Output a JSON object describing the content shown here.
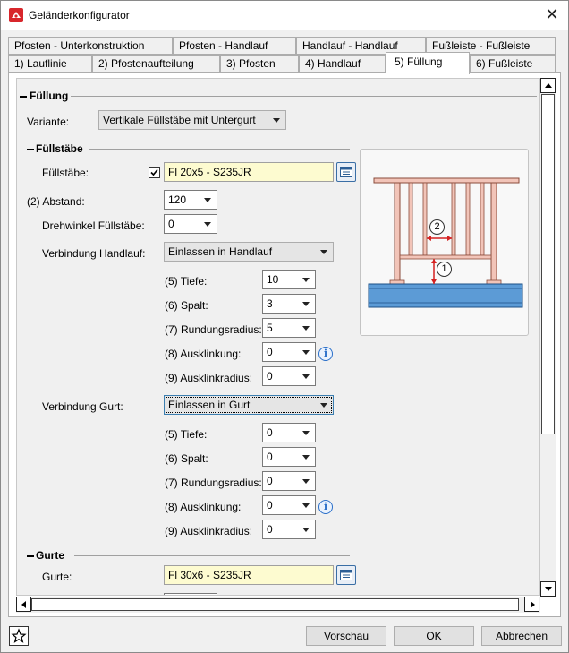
{
  "window": {
    "title": "Geländerkonfigurator"
  },
  "tabs_row1": [
    {
      "label": "Pfosten - Unterkonstruktion"
    },
    {
      "label": "Pfosten - Handlauf"
    },
    {
      "label": "Handlauf - Handlauf"
    },
    {
      "label": "Fußleiste - Fußleiste"
    }
  ],
  "tabs_row2": [
    {
      "label": "1) Lauflinie"
    },
    {
      "label": "2) Pfostenaufteilung"
    },
    {
      "label": "3) Pfosten"
    },
    {
      "label": "4) Handlauf"
    },
    {
      "label": "5) Füllung",
      "active": true
    },
    {
      "label": "6) Fußleiste"
    }
  ],
  "fuellung": {
    "section_title": "Füllung",
    "variante_label": "Variante:",
    "variante_value": "Vertikale Füllstäbe mit Untergurt"
  },
  "fuellstaebe": {
    "section_title": "Füllstäbe",
    "fuellstaebe_label": "Füllstäbe:",
    "fuellstaebe_checked": true,
    "fuellstaebe_value": "Fl 20x5 - S235JR",
    "abstand_label": "(2) Abstand:",
    "abstand_value": "120",
    "drehwinkel_label": "Drehwinkel Füllstäbe:",
    "drehwinkel_value": "0",
    "verbindung_handlauf_label": "Verbindung Handlauf:",
    "verbindung_handlauf_value": "Einlassen in Handlauf",
    "handlauf_params": [
      {
        "label": "(5) Tiefe:",
        "value": "10"
      },
      {
        "label": "(6) Spalt:",
        "value": "3"
      },
      {
        "label": "(7) Rundungsradius:",
        "value": "5"
      },
      {
        "label": "(8) Ausklinkung:",
        "value": "0"
      },
      {
        "label": "(9) Ausklinkradius:",
        "value": "0"
      }
    ],
    "verbindung_gurt_label": "Verbindung Gurt:",
    "verbindung_gurt_value": "Einlassen in Gurt",
    "gurt_params": [
      {
        "label": "(5) Tiefe:",
        "value": "0"
      },
      {
        "label": "(6) Spalt:",
        "value": "0"
      },
      {
        "label": "(7) Rundungsradius:",
        "value": "0"
      },
      {
        "label": "(8) Ausklinkung:",
        "value": "0"
      },
      {
        "label": "(9) Ausklinkradius:",
        "value": "0"
      }
    ]
  },
  "gurte": {
    "section_title": "Gurte",
    "gurte_label": "Gurte:",
    "gurte_value": "Fl 30x6 - S235JR"
  },
  "preview": {
    "marker_1": "1",
    "marker_2": "2"
  },
  "footer": {
    "preview_button": "Vorschau",
    "ok_button": "OK",
    "cancel_button": "Abbrechen"
  },
  "icons": {
    "app": "app-logo-icon",
    "close": "close-icon",
    "catalog": "catalog-icon",
    "info": "info-icon",
    "favorite": "star-icon"
  },
  "colors": {
    "highlight_field": "#fdfbd0",
    "preview_post": "#f2c4b8",
    "preview_floor": "#5c9bd6",
    "dimension_red": "#d42020"
  }
}
